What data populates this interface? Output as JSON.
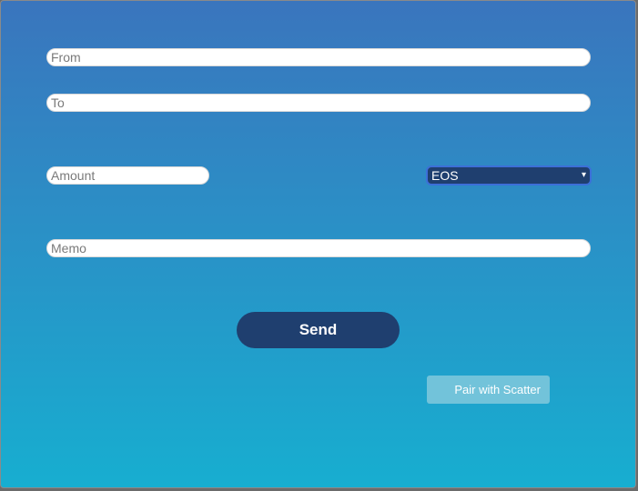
{
  "form": {
    "from": {
      "value": "",
      "placeholder": "From"
    },
    "to": {
      "value": "",
      "placeholder": "To"
    },
    "amount": {
      "value": "",
      "placeholder": "Amount"
    },
    "token": {
      "selected": "EOS",
      "caret": "▾"
    },
    "memo": {
      "value": "",
      "placeholder": "Memo"
    },
    "send_label": "Send",
    "pair_label": "Pair with Scatter"
  },
  "colors": {
    "background_top": "#3a75bd",
    "background_bottom": "#17aed0",
    "button_dark": "#1f3f6f",
    "scatter_button": "#72c3da",
    "select_border": "#3c6fd8"
  }
}
